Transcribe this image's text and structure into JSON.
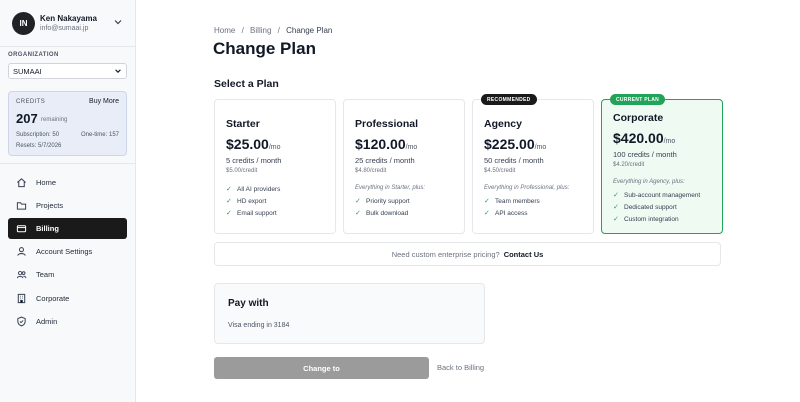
{
  "user": {
    "initials": "IN",
    "name": "Ken Nakayama",
    "email": "info@sumaai.jp"
  },
  "organization": {
    "label": "ORGANIZATION",
    "selected": "SUMAAI"
  },
  "credits": {
    "label": "CREDITS",
    "buy_more": "Buy More",
    "amount": "207",
    "remaining": "remaining",
    "subscription": "Subscription: 50",
    "one_time": "One-time: 157",
    "resets": "Resets: 5/7/2026"
  },
  "nav": [
    {
      "label": "Home",
      "icon": "home-icon"
    },
    {
      "label": "Projects",
      "icon": "folder-icon"
    },
    {
      "label": "Billing",
      "icon": "credit-card-icon",
      "active": true
    },
    {
      "label": "Account Settings",
      "icon": "user-icon"
    },
    {
      "label": "Team",
      "icon": "users-icon"
    },
    {
      "label": "Corporate",
      "icon": "building-icon"
    },
    {
      "label": "Admin",
      "icon": "shield-icon"
    }
  ],
  "breadcrumb": {
    "home": "Home",
    "billing": "Billing",
    "current": "Change Plan",
    "sep": "/"
  },
  "page_title": "Change Plan",
  "section_title": "Select a Plan",
  "plans": [
    {
      "name": "Starter",
      "price": "$25.00",
      "period": "/mo",
      "credits": "5 credits / month",
      "per_credit": "$5.00/credit",
      "includes": "",
      "features": [
        "All AI providers",
        "HD export",
        "Email support"
      ]
    },
    {
      "name": "Professional",
      "price": "$120.00",
      "period": "/mo",
      "credits": "25 credits / month",
      "per_credit": "$4.80/credit",
      "includes": "Everything in Starter, plus:",
      "features": [
        "Priority support",
        "Bulk download"
      ]
    },
    {
      "name": "Agency",
      "price": "$225.00",
      "period": "/mo",
      "credits": "50 credits / month",
      "per_credit": "$4.50/credit",
      "includes": "Everything in Professional, plus:",
      "features": [
        "Team members",
        "API access"
      ],
      "badge": "RECOMMENDED"
    },
    {
      "name": "Corporate",
      "price": "$420.00",
      "period": "/mo",
      "credits": "100 credits / month",
      "per_credit": "$4.20/credit",
      "includes": "Everything in Agency, plus:",
      "features": [
        "Sub-account management",
        "Dedicated support",
        "Custom integration"
      ],
      "badge": "CURRENT PLAN"
    }
  ],
  "enterprise": {
    "text": "Need custom enterprise pricing?",
    "link": "Contact Us"
  },
  "payment": {
    "heading": "Pay with",
    "method": "Visa ending in 3184"
  },
  "actions": {
    "change": "Change to",
    "back": "Back to Billing"
  },
  "colors": {
    "accent_green": "#22a35a",
    "current_bg": "#eefaf2",
    "badge_dark": "#1a1a1a",
    "button_disabled": "#9b9b9b"
  }
}
